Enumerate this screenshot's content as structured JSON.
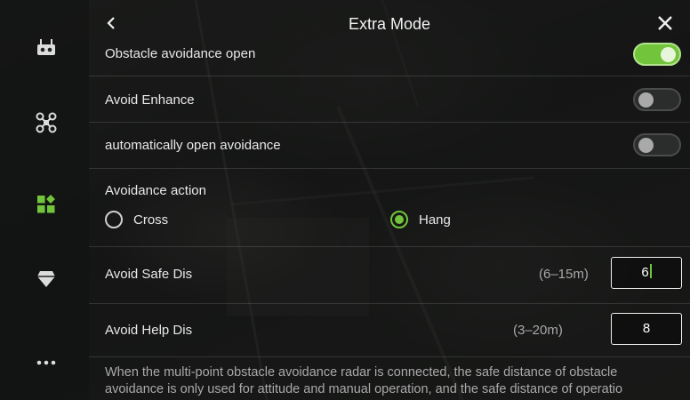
{
  "header": {
    "title": "Extra Mode"
  },
  "sidebar": {
    "items": [
      {
        "icon": "remote-controller-icon"
      },
      {
        "icon": "drone-icon"
      },
      {
        "icon": "apps-grid-icon",
        "active": true
      },
      {
        "icon": "gem-icon"
      },
      {
        "icon": "more-dots-icon"
      }
    ]
  },
  "settings": {
    "obstacle_avoidance": {
      "label": "Obstacle avoidance open",
      "on": true
    },
    "avoid_enhance": {
      "label": "Avoid Enhance",
      "on": false
    },
    "auto_open": {
      "label": "automatically open avoidance",
      "on": false
    },
    "action": {
      "label": "Avoidance action",
      "options": [
        "Cross",
        "Hang"
      ],
      "selected": "Hang"
    },
    "safe_dis": {
      "label": "Avoid Safe Dis",
      "range": "(6–15m)",
      "value": "6"
    },
    "help_dis": {
      "label": "Avoid Help Dis",
      "range": "(3–20m)",
      "value": "8"
    }
  },
  "note": {
    "line1": "When the multi-point obstacle avoidance radar is connected, the safe distance of obstacle",
    "line2": "avoidance is only used for attitude and manual operation, and the safe distance of operatio"
  },
  "colors": {
    "accent": "#72c43a"
  }
}
